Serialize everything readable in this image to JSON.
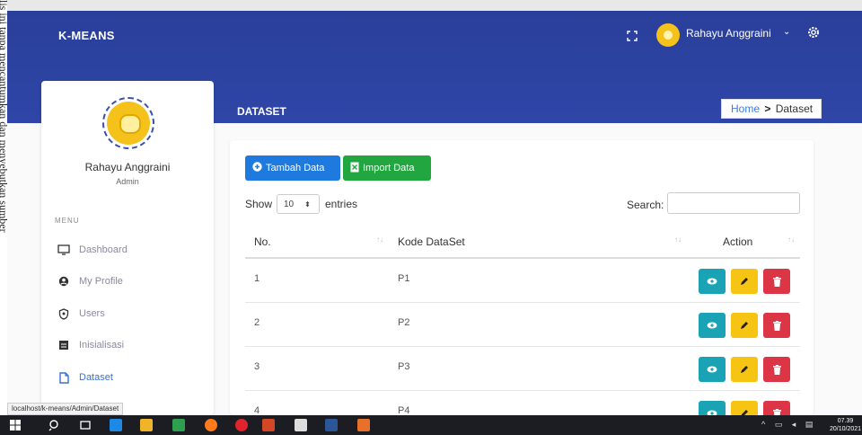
{
  "doc_strip_text": "lis ini tanpa mencantumkan dan menyebutkan sumber",
  "header": {
    "brand": "K-MEANS",
    "user_name": "Rahayu Anggraini",
    "page_title": "DATASET"
  },
  "breadcrumb": {
    "home": "Home",
    "separator": ">",
    "current": "Dataset"
  },
  "sidebar": {
    "name": "Rahayu Anggraini",
    "role": "Admin",
    "menu_heading": "MENU",
    "items": [
      {
        "label": "Dashboard",
        "icon": "monitor-icon"
      },
      {
        "label": "My Profile",
        "icon": "profile-icon"
      },
      {
        "label": "Users",
        "icon": "shield-icon"
      },
      {
        "label": "Inisialisasi",
        "icon": "grid-icon"
      },
      {
        "label": "Dataset",
        "icon": "file-icon",
        "active": true
      }
    ]
  },
  "toolbar": {
    "add_label": "Tambah Data",
    "import_label": "Import Data"
  },
  "table_controls": {
    "show_label": "Show",
    "entries_value": "10",
    "entries_label": "entries",
    "search_label": "Search:"
  },
  "table": {
    "columns": [
      "No.",
      "Kode DataSet",
      "Action"
    ],
    "rows": [
      {
        "no": "1",
        "kode": "P1"
      },
      {
        "no": "2",
        "kode": "P2"
      },
      {
        "no": "3",
        "kode": "P3"
      },
      {
        "no": "4",
        "kode": "P4"
      }
    ]
  },
  "status_url": "localhost/k-means/Admin/Dataset",
  "taskbar": {
    "time": "07.39",
    "date": "20/10/2021"
  },
  "colors": {
    "header": "#2f46a8",
    "primary_button": "#1f7ae0",
    "success_button": "#22a63f",
    "view_button": "#1aa3b5",
    "edit_button": "#f6c513",
    "delete_button": "#dc3545"
  }
}
